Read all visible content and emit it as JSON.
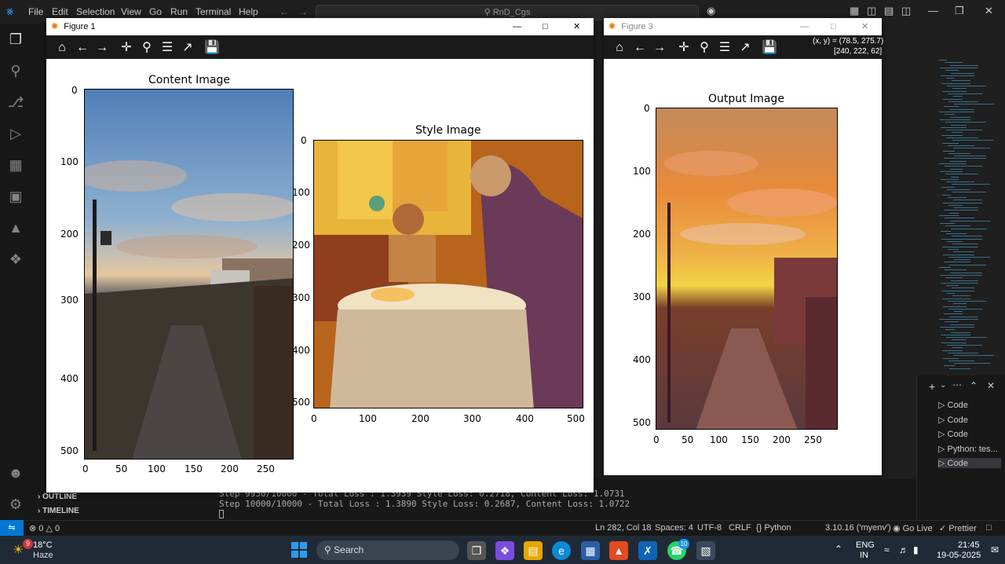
{
  "vscode": {
    "menu": [
      "File",
      "Edit",
      "Selection",
      "View",
      "Go",
      "Run",
      "Terminal",
      "Help"
    ],
    "command_center": "RnD_Cgs",
    "outline_label": "OUTLINE",
    "timeline_label": "TIMELINE",
    "terminal_lines": [
      "Step 9950/10000 - Total Loss : 1.3939 Style Loss: 0.2718, Content Loss: 1.0731",
      "Step 10000/10000 - Total Loss : 1.3890 Style Loss: 0.2687, Content Loss: 1.0722"
    ],
    "panel_items": [
      "Code",
      "Code",
      "Code",
      "Python: tes...",
      "Code"
    ],
    "status": {
      "errors": "0",
      "warnings": "0",
      "position": "Ln 282, Col 18",
      "spaces": "Spaces: 4",
      "encoding": "UTF-8",
      "eol": "CRLF",
      "language": "Python",
      "interpreter": "3.10.16 ('myenv')",
      "go_live": "Go Live",
      "prettier": "Prettier"
    }
  },
  "figure1": {
    "title": "Figure 1",
    "content": {
      "title": "Content Image",
      "yticks": [
        "0",
        "100",
        "200",
        "300",
        "400",
        "500"
      ],
      "xticks": [
        "0",
        "50",
        "100",
        "150",
        "200",
        "250"
      ]
    },
    "style": {
      "title": "Style Image",
      "yticks": [
        "0",
        "100",
        "200",
        "300",
        "400",
        "500"
      ],
      "xticks": [
        "0",
        "100",
        "200",
        "300",
        "400",
        "500"
      ]
    }
  },
  "figure3": {
    "title": "Figure 3",
    "coords": "(x, y) = (78.5, 275.7)",
    "pixel": "[240, 222, 62]",
    "output": {
      "title": "Output Image",
      "yticks": [
        "0",
        "100",
        "200",
        "300",
        "400",
        "500"
      ],
      "xticks": [
        "0",
        "50",
        "100",
        "150",
        "200",
        "250"
      ]
    }
  },
  "taskbar": {
    "weather_temp": "18°C",
    "weather_desc": "Haze",
    "weather_badge": "9",
    "search_label": "Search",
    "whatsapp_badge": "10",
    "lang_line1": "ENG",
    "lang_line2": "IN",
    "time": "21:45",
    "date": "19-05-2025"
  },
  "colors": {
    "vscode_blue": "#0078d4",
    "taskbar_bg": "#202a36"
  }
}
